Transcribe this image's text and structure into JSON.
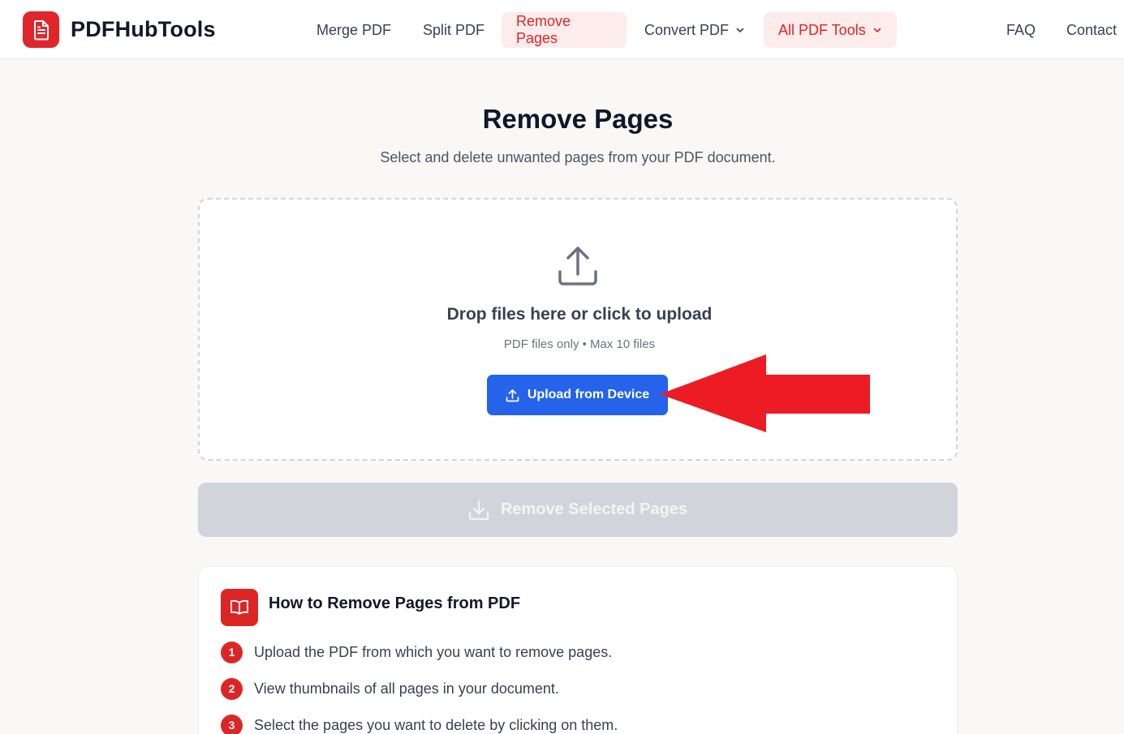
{
  "header": {
    "brand": "PDFHubTools",
    "logo_icon": "document-icon",
    "nav": [
      {
        "label": "Merge PDF",
        "active": false,
        "dropdown": false
      },
      {
        "label": "Split PDF",
        "active": false,
        "dropdown": false
      },
      {
        "label": "Remove Pages",
        "active": true,
        "dropdown": false
      },
      {
        "label": "Convert PDF",
        "active": false,
        "dropdown": true
      },
      {
        "label": "All PDF Tools",
        "active": true,
        "dropdown": true
      },
      {
        "label": "FAQ",
        "active": false,
        "dropdown": false
      },
      {
        "label": "Contact",
        "active": false,
        "dropdown": false
      }
    ]
  },
  "main": {
    "title": "Remove Pages",
    "subtitle": "Select and delete unwanted pages from your PDF document."
  },
  "dropzone": {
    "icon": "upload-icon",
    "title": "Drop files here or click to upload",
    "note": "PDF files only • Max 10 files",
    "button_label": "Upload from Device"
  },
  "remove_button": {
    "label": "Remove Selected Pages",
    "icon": "download-icon"
  },
  "howto": {
    "icon": "book-icon",
    "title": "How to Remove Pages from PDF",
    "steps": [
      {
        "num": "1",
        "text": "Upload the PDF from which you want to remove pages."
      },
      {
        "num": "2",
        "text": "View thumbnails of all pages in your document."
      },
      {
        "num": "3",
        "text": "Select the pages you want to delete by clicking on them."
      }
    ]
  },
  "colors": {
    "brand_red": "#e0262b",
    "primary_blue": "#2563eb",
    "annotation_arrow": "#ed1c24",
    "disabled_gray": "#d1d5db"
  }
}
